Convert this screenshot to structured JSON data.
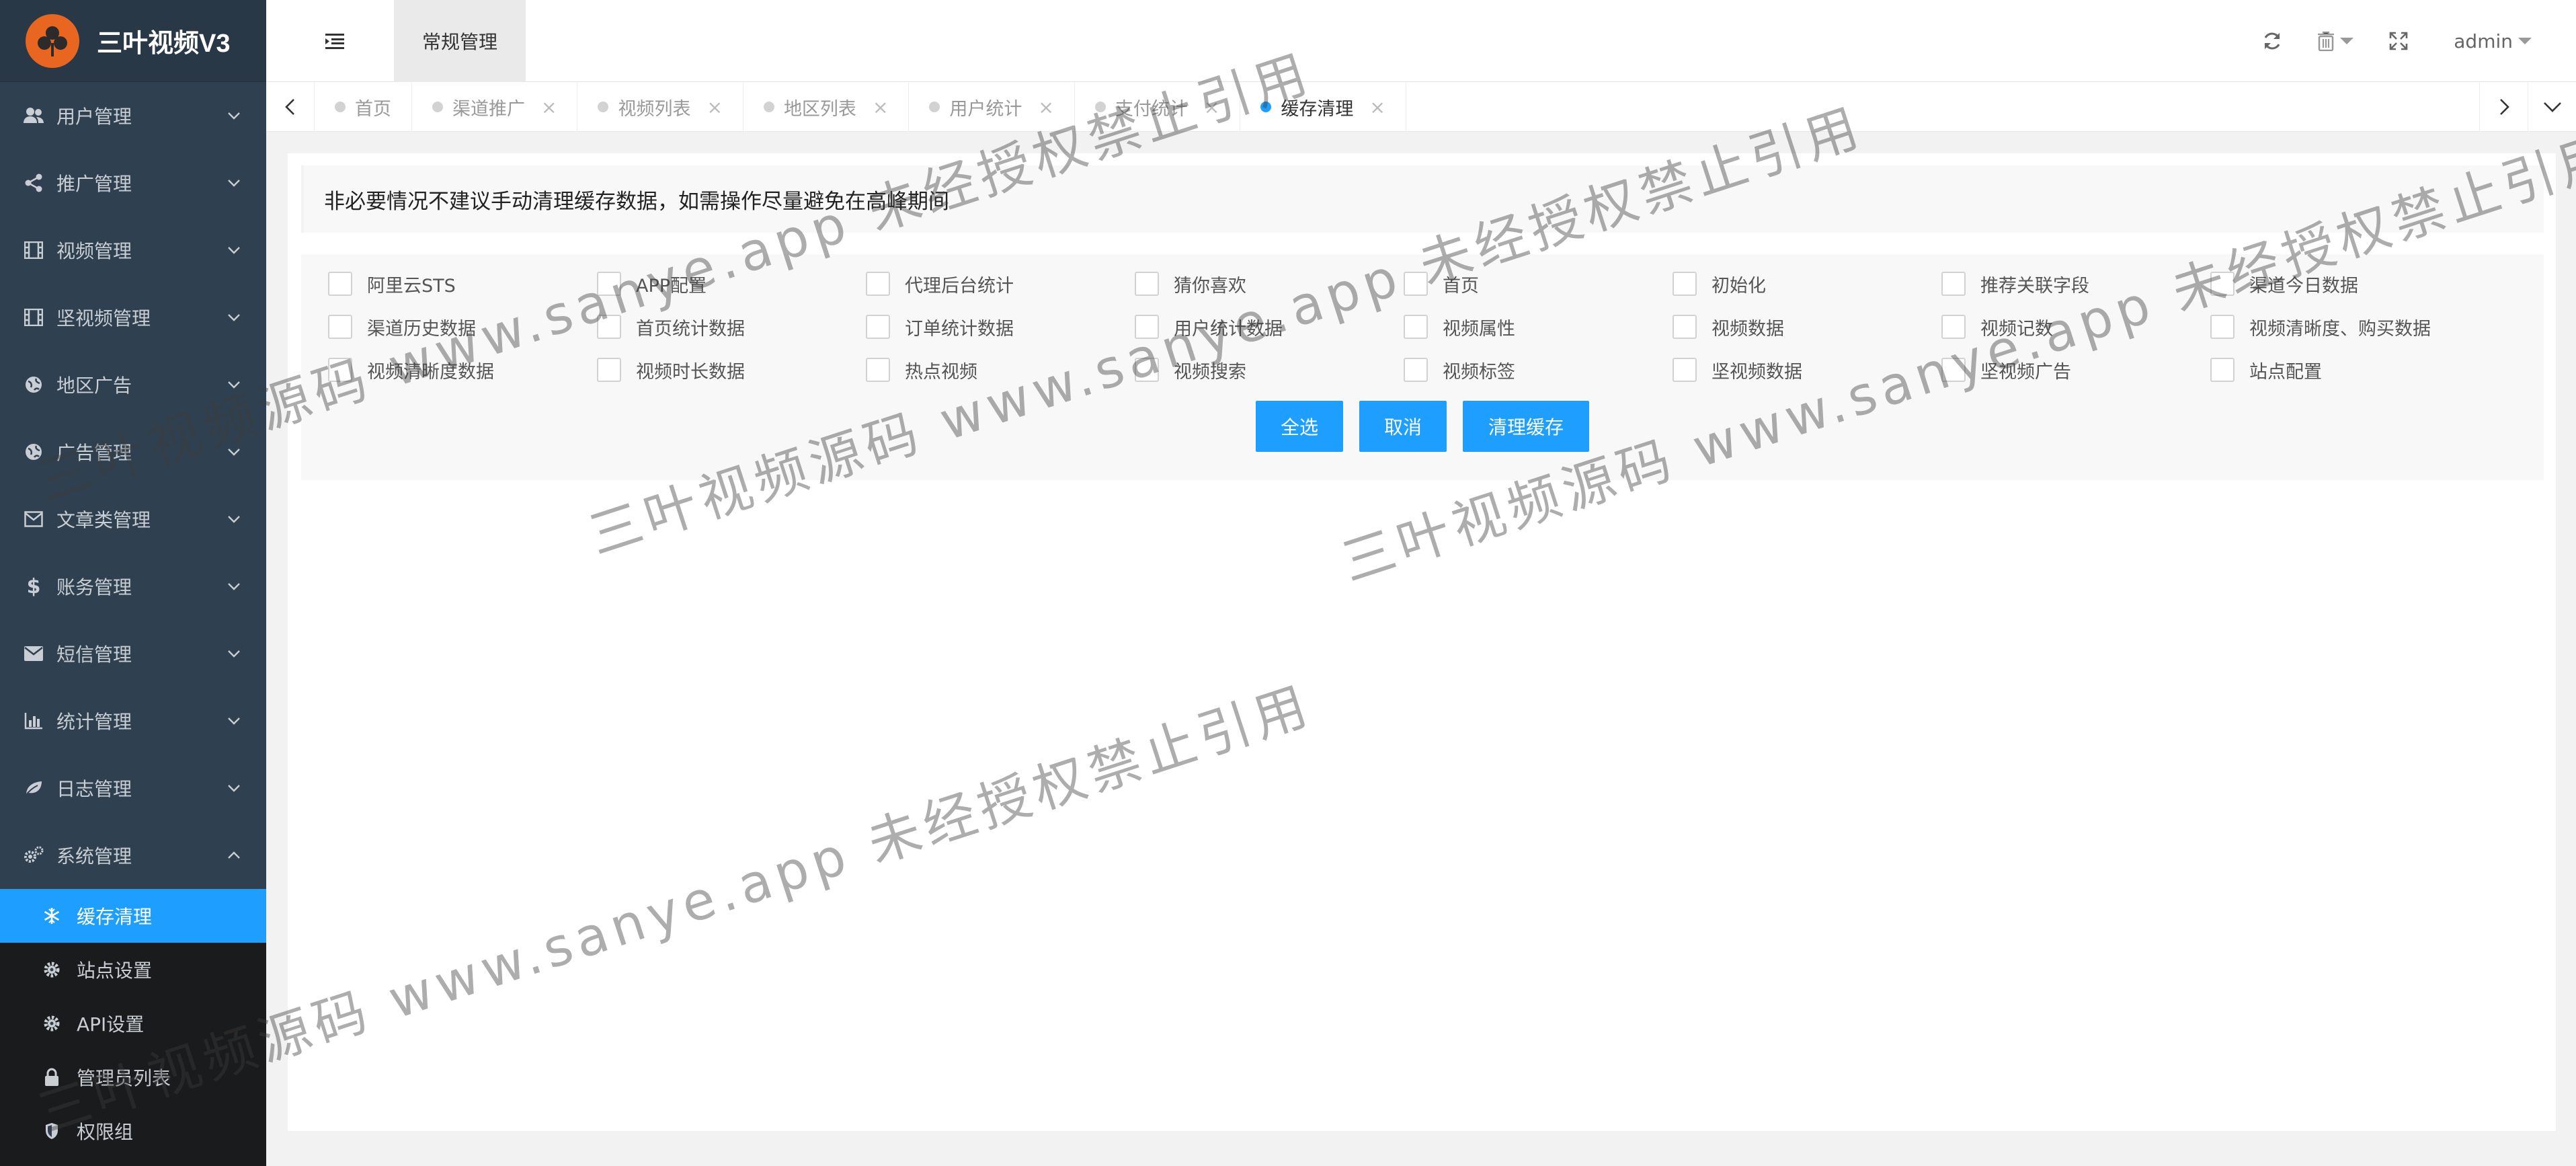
{
  "app": {
    "title": "三叶视频V3"
  },
  "sidebar": {
    "menu": [
      {
        "label": "用户管理",
        "icon": "users-icon"
      },
      {
        "label": "推广管理",
        "icon": "share-icon"
      },
      {
        "label": "视频管理",
        "icon": "film-icon"
      },
      {
        "label": "坚视频管理",
        "icon": "film-icon"
      },
      {
        "label": "地区广告",
        "icon": "globe-icon"
      },
      {
        "label": "广告管理",
        "icon": "globe-icon"
      },
      {
        "label": "文章类管理",
        "icon": "envelope-open-icon"
      },
      {
        "label": "账务管理",
        "icon": "dollar-icon"
      },
      {
        "label": "短信管理",
        "icon": "envelope-icon"
      },
      {
        "label": "统计管理",
        "icon": "bar-chart-icon"
      },
      {
        "label": "日志管理",
        "icon": "leaf-icon"
      },
      {
        "label": "系统管理",
        "icon": "cogs-icon"
      }
    ],
    "submenu": [
      {
        "label": "缓存清理",
        "icon": "snowflake-icon"
      },
      {
        "label": "站点设置",
        "icon": "gear-icon"
      },
      {
        "label": "API设置",
        "icon": "gear-icon"
      },
      {
        "label": "管理员列表",
        "icon": "lock-icon"
      },
      {
        "label": "权限组",
        "icon": "shield-icon"
      }
    ]
  },
  "header": {
    "top_tab": "常规管理",
    "user": "admin"
  },
  "tabs": [
    {
      "label": "首页"
    },
    {
      "label": "渠道推广"
    },
    {
      "label": "视频列表"
    },
    {
      "label": "地区列表"
    },
    {
      "label": "用户统计"
    },
    {
      "label": "支付统计"
    },
    {
      "label": "缓存清理"
    }
  ],
  "tab_close": "×",
  "main": {
    "notice": "非必要情况不建议手动清理缓存数据，如需操作尽量避免在高峰期间",
    "options": [
      "阿里云STS",
      "APP配置",
      "代理后台统计",
      "猜你喜欢",
      "首页",
      "初始化",
      "推荐关联字段",
      "渠道今日数据",
      "渠道历史数据",
      "首页统计数据",
      "订单统计数据",
      "用户统计数据",
      "视频属性",
      "视频数据",
      "视频记数",
      "视频清晰度、购买数据",
      "视频清晰度数据",
      "视频时长数据",
      "热点视频",
      "视频搜索",
      "视频标签",
      "坚视频数据",
      "坚视频广告",
      "站点配置"
    ],
    "buttons": {
      "select_all": "全选",
      "cancel": "取消",
      "clear": "清理缓存"
    }
  },
  "watermark": "三叶视频源码 www.sanye.app 未经授权禁止引用",
  "colors": {
    "sidebar_bg": "#2f4050",
    "accent": "#1e9fff",
    "logo": "#e8661f"
  }
}
